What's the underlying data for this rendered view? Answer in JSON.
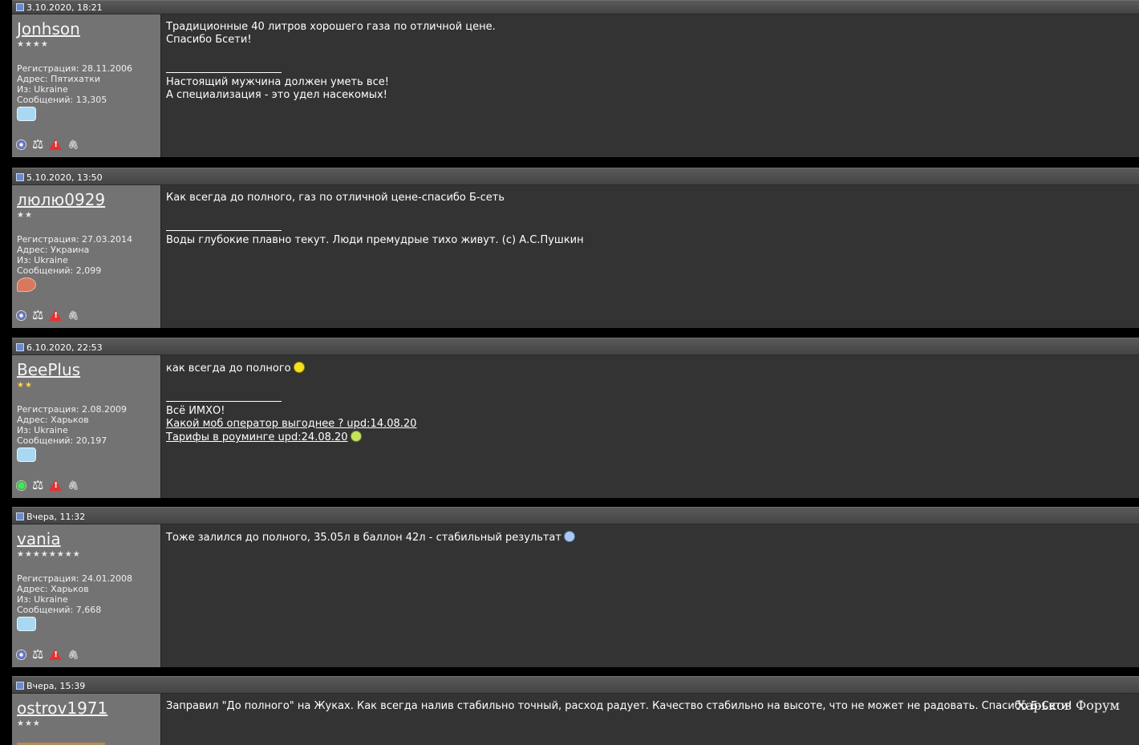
{
  "posts": [
    {
      "date": "3.10.2020, 18:21",
      "username": "Jonhson",
      "stars": "★★★★",
      "star_color": "white",
      "registration": "Регистрация: 28.11.2006",
      "address": "Адрес: Пятихатки",
      "from": "Из: Ukraine",
      "messages": "Сообщений: 13,305",
      "badge_icon": "camera-badge-icon",
      "status_icon": "offline-status-icon",
      "text_lines": [
        "Традиционные 40 литров хорошего газа по отличной цене.",
        "Спасибо Бсети!"
      ],
      "signature_lines": [
        "Настоящий мужчина должен уметь все!",
        "А специализация - это удел насекомых!"
      ]
    },
    {
      "date": "5.10.2020, 13:50",
      "username": "люлю0929",
      "stars": "★★",
      "star_color": "white",
      "registration": "Регистрация: 27.03.2014",
      "address": "Адрес: Украина",
      "from": "Из: Ukraine",
      "messages": "Сообщений: 2,099",
      "badge_icon": "pin-badge-icon",
      "status_icon": "offline-status-icon",
      "text_lines": [
        "Как всегда до полного, газ по отличной цене-спасибо Б-сеть"
      ],
      "signature_lines": [
        "Воды глубокие плавно текут. Люди премудрые тихо живут. (с) А.С.Пушкин"
      ]
    },
    {
      "date": "6.10.2020, 22:53",
      "username": "BeePlus",
      "stars": "★★",
      "star_color": "gold",
      "registration": "Регистрация: 2.08.2009",
      "address": "Адрес: Харьков",
      "from": "Из: Ukraine",
      "messages": "Сообщений: 20,197",
      "badge_icon": "camera-badge-icon",
      "status_icon": "online-status-icon",
      "text": "как всегда до полного",
      "signature_text": "Всё ИМХО!",
      "signature_links": [
        "Какой моб оператор выгоднее ? upd:14.08.20",
        "Тарифы в роуминге upd:24.08.20"
      ]
    },
    {
      "date": "Вчера, 11:32",
      "username": "vania",
      "stars": "★★★★★★★★",
      "star_color": "white",
      "registration": "Регистрация: 24.01.2008",
      "address": "Адрес: Харьков",
      "from": "Из: Ukraine",
      "messages": "Сообщений: 7,668",
      "badge_icon": "camera-badge-icon",
      "status_icon": "offline-status-icon",
      "text": "Тоже залился до полного, 35.05л в баллон 42л - стабильный результат"
    },
    {
      "date": "Вчера, 15:39",
      "username": "ostrov1971",
      "stars": "★★★",
      "star_color": "white",
      "text": "Заправил \"До полного\" на Жуках. Как всегда налив стабильно точный, расход радует. Качество стабильно на высоте, что не может не радовать. Спасибо Б-Сети!"
    }
  ],
  "watermark": "Харьков Форум",
  "icons": {
    "scales": "scales-icon",
    "warning": "warning-icon",
    "clip": "paperclip-icon"
  }
}
